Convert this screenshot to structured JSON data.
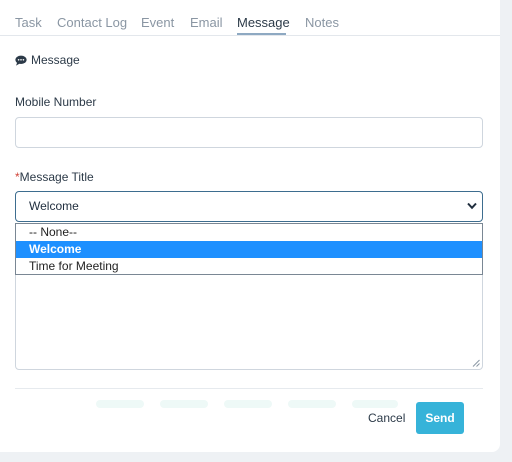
{
  "tabs": [
    {
      "label": "Task"
    },
    {
      "label": "Contact Log"
    },
    {
      "label": "Event"
    },
    {
      "label": "Email"
    },
    {
      "label": "Message",
      "active": true
    },
    {
      "label": "Notes"
    }
  ],
  "section": {
    "title": "Message",
    "icon": "chat-bubble-icon"
  },
  "mobile": {
    "label": "Mobile Number",
    "value": ""
  },
  "message_title": {
    "required_mark": "*",
    "label": "Message Title",
    "selected": "Welcome",
    "options": [
      "-- None--",
      "Welcome",
      "Time for Meeting"
    ]
  },
  "actions": {
    "cancel": "Cancel",
    "send": "Send"
  },
  "colors": {
    "accent": "#36b3d9",
    "highlight": "#1e90ff",
    "tab_underline": "#8ea9c2"
  }
}
